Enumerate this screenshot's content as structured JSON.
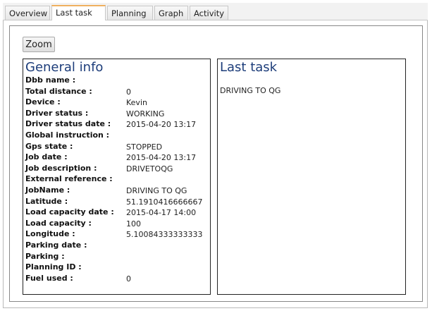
{
  "tabs": [
    {
      "label": "Overview",
      "active": false
    },
    {
      "label": "Last task",
      "active": true
    },
    {
      "label": "Planning",
      "active": false
    },
    {
      "label": "Graph",
      "active": false
    },
    {
      "label": "Activity",
      "active": false
    }
  ],
  "toolbar": {
    "zoom_label": "Zoom"
  },
  "general_info": {
    "title": "General info",
    "rows": [
      {
        "label": "Dbb name :",
        "value": ""
      },
      {
        "label": "Total distance :",
        "value": "0"
      },
      {
        "label": "Device :",
        "value": "Kevin"
      },
      {
        "label": "Driver status :",
        "value": "WORKING"
      },
      {
        "label": "Driver status date :",
        "value": "2015-04-20 13:17"
      },
      {
        "label": "Global instruction :",
        "value": ""
      },
      {
        "label": "Gps state :",
        "value": "STOPPED"
      },
      {
        "label": "Job date :",
        "value": "2015-04-20 13:17"
      },
      {
        "label": "Job description :",
        "value": "DRIVETOQG"
      },
      {
        "label": "External reference :",
        "value": ""
      },
      {
        "label": "JobName :",
        "value": "DRIVING TO QG"
      },
      {
        "label": "Latitude :",
        "value": "51.1910416666667"
      },
      {
        "label": "Load capacity date :",
        "value": "2015-04-17 14:00"
      },
      {
        "label": "Load capacity :",
        "value": "100"
      },
      {
        "label": "Longitude :",
        "value": "5.10084333333333"
      },
      {
        "label": "Parking date :",
        "value": ""
      },
      {
        "label": "Parking :",
        "value": ""
      },
      {
        "label": "Planning ID :",
        "value": ""
      },
      {
        "label": "Fuel used :",
        "value": "0"
      }
    ]
  },
  "last_task": {
    "title": "Last task",
    "text": "DRIVING TO QG"
  },
  "colors": {
    "title": "#1d3d7a",
    "active_tab_accent": "#f0a050"
  }
}
